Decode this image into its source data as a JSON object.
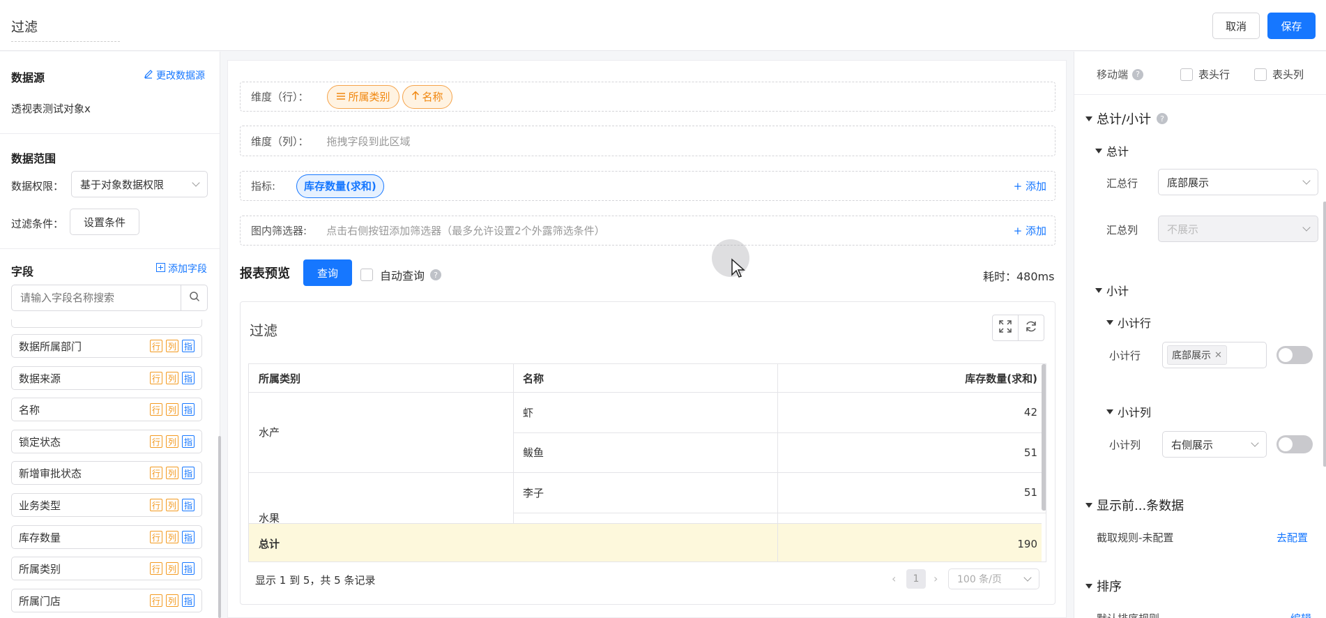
{
  "header": {
    "title": "过滤",
    "cancel_label": "取消",
    "save_label": "保存"
  },
  "left": {
    "datasource_title": "数据源",
    "change_datasource": "更改数据源",
    "datasource_name": "透视表测试对象x",
    "range_title": "数据范围",
    "permission_label": "数据权限：",
    "permission_value": "基于对象数据权限",
    "filter_label": "过滤条件：",
    "filter_button": "设置条件",
    "fields_title": "字段",
    "add_field": "添加字段",
    "search_placeholder": "请输入字段名称搜索",
    "tag_row": "行",
    "tag_col": "列",
    "tag_metric": "指",
    "fields": [
      "数据所属部门",
      "数据来源",
      "名称",
      "锁定状态",
      "新增审批状态",
      "业务类型",
      "库存数量",
      "所属类别",
      "所属门店"
    ]
  },
  "config": {
    "dim_row_label": "维度（行）：",
    "dim_row_pills": [
      "所属类别",
      "名称"
    ],
    "dim_col_label": "维度（列）：",
    "dim_col_placeholder": "拖拽字段到此区域",
    "metric_label": "指标:",
    "metric_pill": "库存数量(求和)",
    "filter_label": "图内筛选器:",
    "filter_placeholder": "点击右侧按钮添加筛选器（最多允许设置2个外露筛选条件）",
    "add_label": "添加"
  },
  "preview": {
    "title": "报表预览",
    "query_button": "查询",
    "auto_query": "自动查询",
    "elapsed": "耗时：480ms",
    "panel_title": "过滤",
    "table": {
      "headers": [
        "所属类别",
        "名称",
        "库存数量(求和)"
      ],
      "groups": [
        {
          "category": "水产",
          "rows": [
            {
              "name": "虾",
              "value": "42"
            },
            {
              "name": "鲅鱼",
              "value": "51"
            }
          ]
        },
        {
          "category": "水果",
          "rows": [
            {
              "name": "李子",
              "value": "51"
            }
          ]
        }
      ],
      "total_label": "总计",
      "total_value": "190"
    },
    "footer": "显示 1 到 5，共 5 条记录",
    "page": "1",
    "page_size": "100 条/页"
  },
  "right": {
    "mobile_label": "移动端",
    "header_row": "表头行",
    "header_col": "表头列",
    "total_subtotal_title": "总计/小计",
    "total_title": "总计",
    "sum_row_label": "汇总行",
    "sum_row_value": "底部展示",
    "sum_col_label": "汇总列",
    "sum_col_value": "不展示",
    "subtotal_title": "小计",
    "subtotal_row_title": "小计行",
    "subtotal_row_label": "小计行",
    "subtotal_row_tag": "底部展示",
    "subtotal_col_title": "小计列",
    "subtotal_col_label": "小计列",
    "subtotal_col_value": "右侧展示",
    "show_top_title": "显示前...条数据",
    "truncate_rule": "截取规则-未配置",
    "go_config": "去配置",
    "sort_title": "排序",
    "default_sort": "默认排序规则",
    "edit_label": "编辑"
  }
}
